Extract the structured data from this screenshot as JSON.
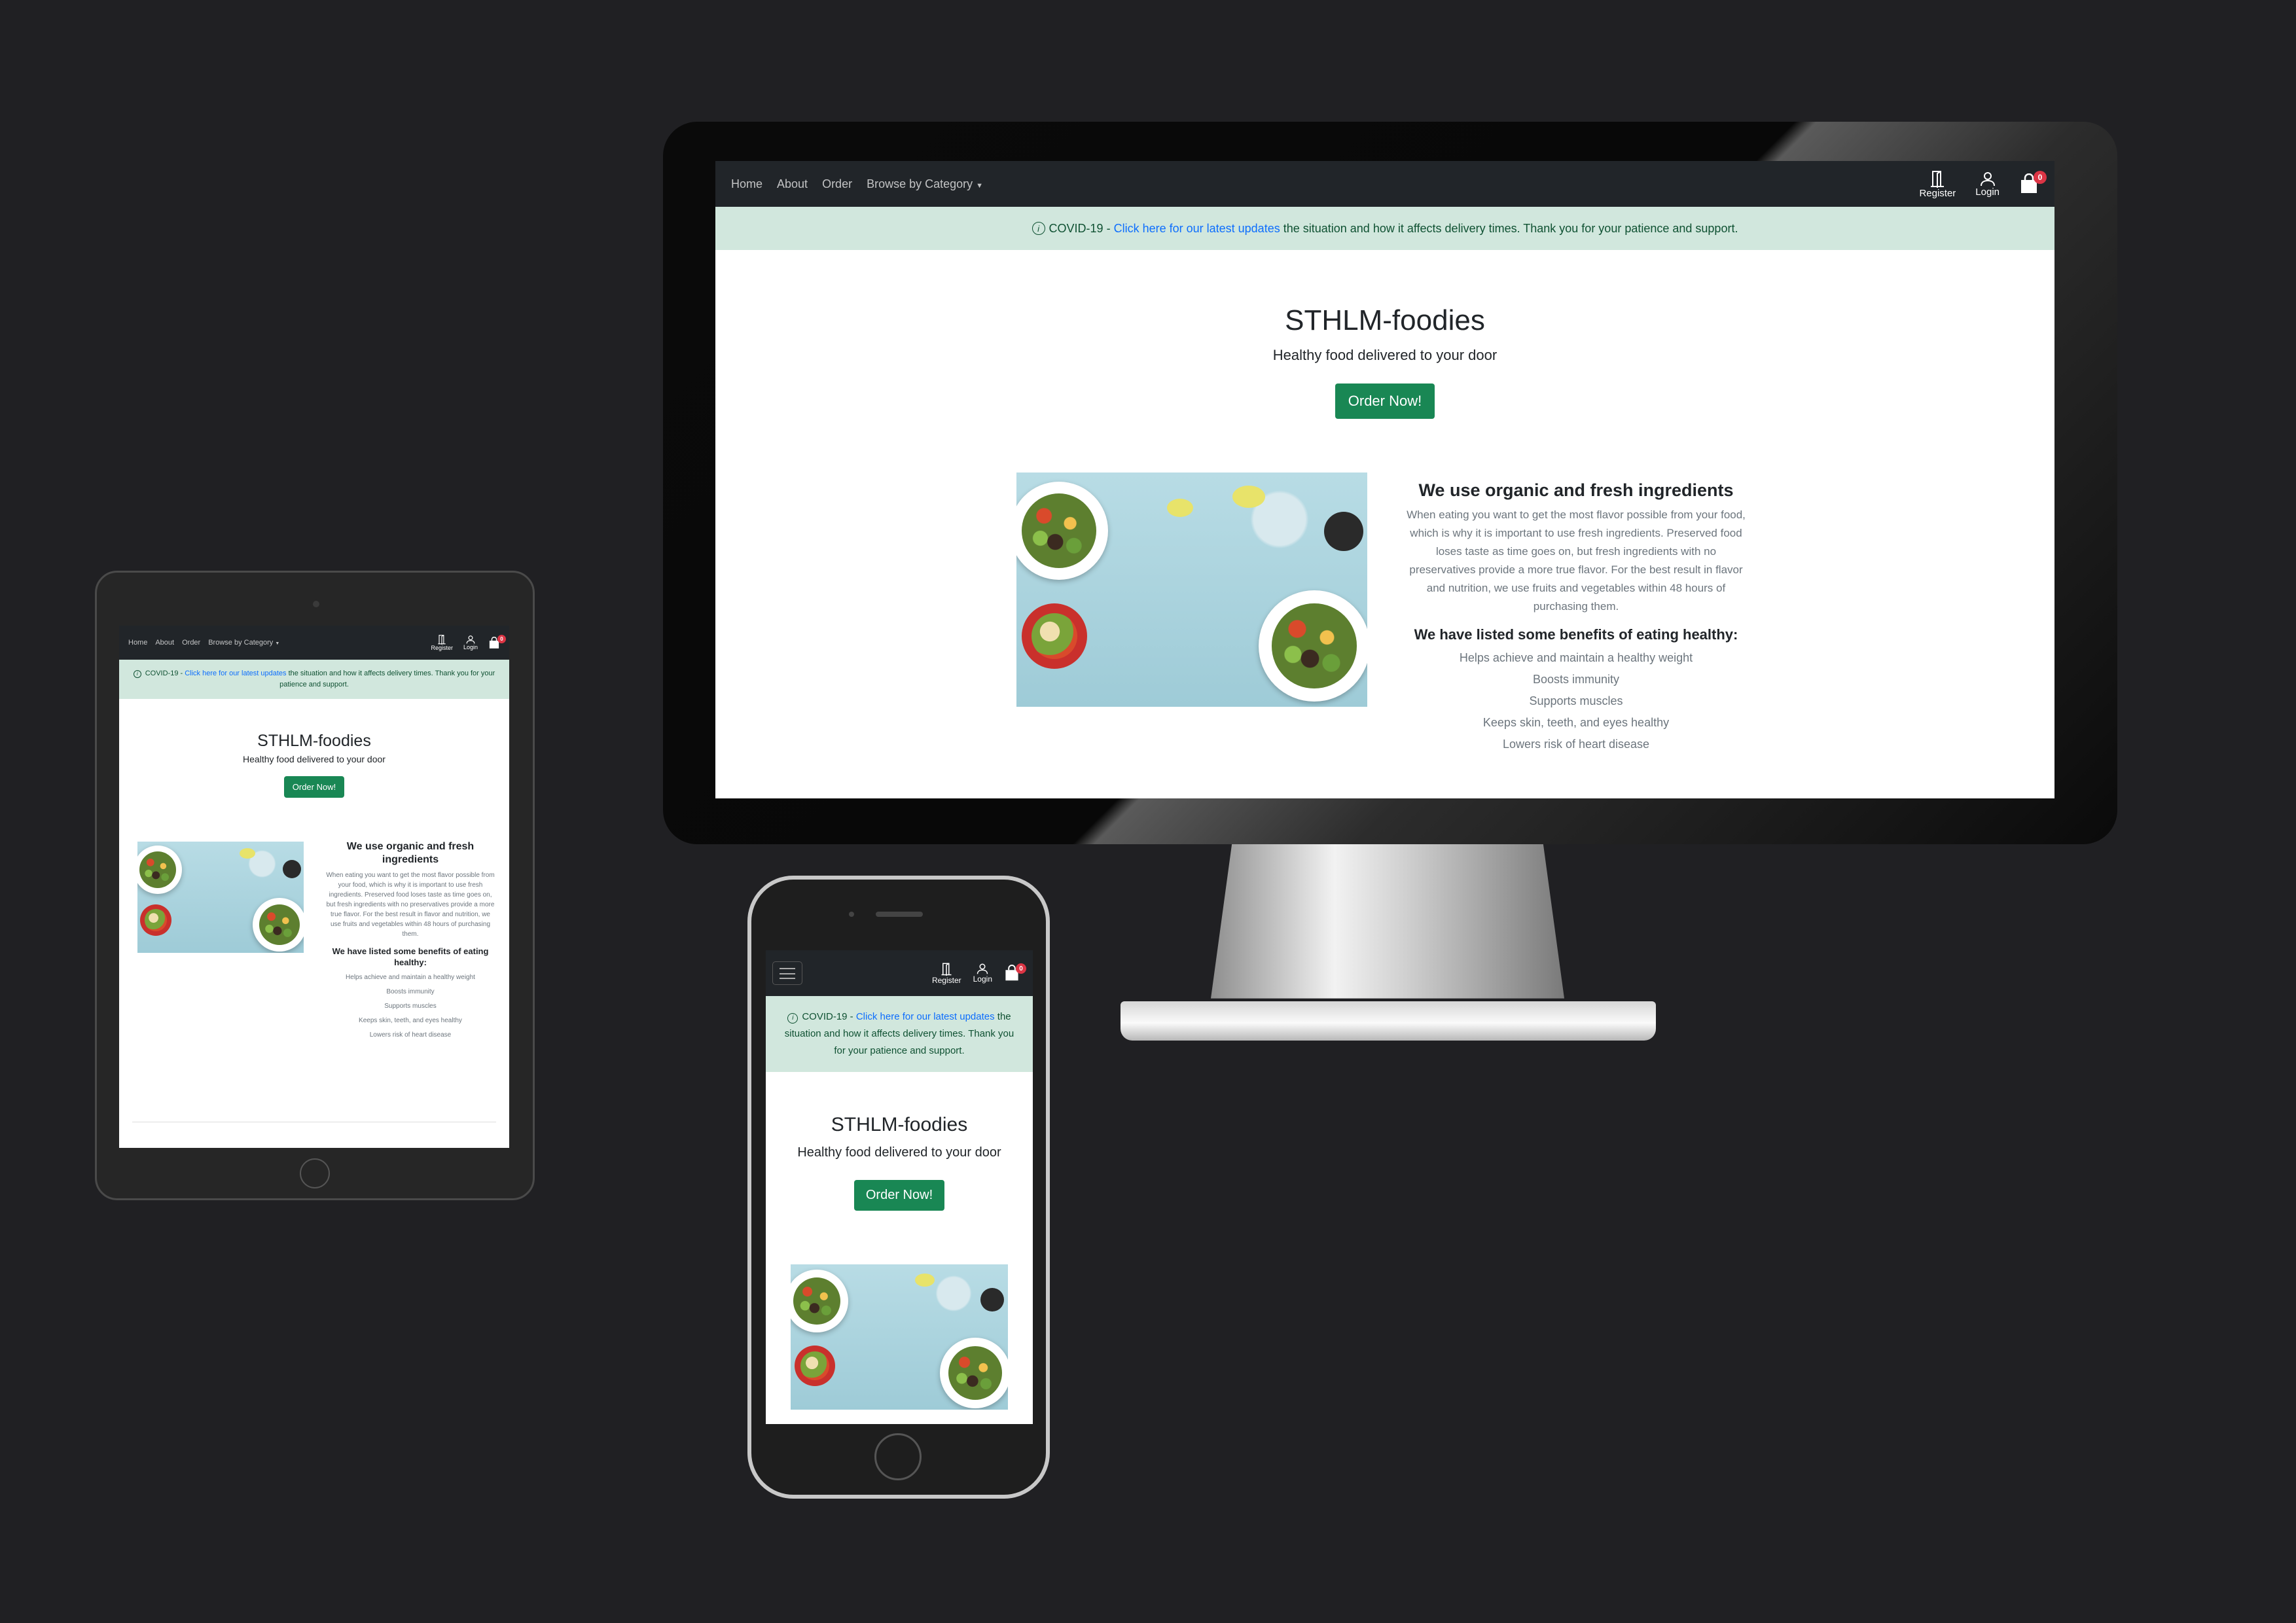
{
  "site": {
    "nav": {
      "links": [
        "Home",
        "About",
        "Order",
        "Browse by Category"
      ],
      "register_label": "Register",
      "login_label": "Login",
      "cart_count": "0"
    },
    "alert": {
      "prefix": "COVID-19 - ",
      "link_text": "Click here for our latest updates",
      "suffix": " the situation and how it affects delivery times. Thank you for your patience and support."
    },
    "hero": {
      "title": "STHLM-foodies",
      "subtitle": "Healthy food delivered to your door",
      "cta_label": "Order Now!"
    },
    "info": {
      "heading": "We use organic and fresh ingredients",
      "body": "When eating you want to get the most flavor possible from your food, which is why it is important to use fresh ingredients. Preserved food loses taste as time goes on, but fresh ingredients with no preservatives provide a more true flavor. For the best result in flavor and nutrition, we use fruits and vegetables within 48 hours of purchasing them.",
      "benefits_heading": "We have listed some benefits of eating healthy:",
      "benefits": [
        "Helps achieve and maintain a healthy weight",
        "Boosts immunity",
        "Supports muscles",
        "Keeps skin, teeth, and eyes healthy",
        "Lowers risk of heart disease"
      ]
    }
  },
  "colors": {
    "navbar": "#212529",
    "alert_bg": "#d1e7dd",
    "alert_text": "#0f5132",
    "link": "#0d6efd",
    "button": "#198754",
    "badge": "#dc3545",
    "backdrop": "#202023"
  },
  "icons": [
    "door-icon",
    "user-icon",
    "bag-icon",
    "info-icon",
    "hamburger-icon",
    "caret-down-icon"
  ]
}
